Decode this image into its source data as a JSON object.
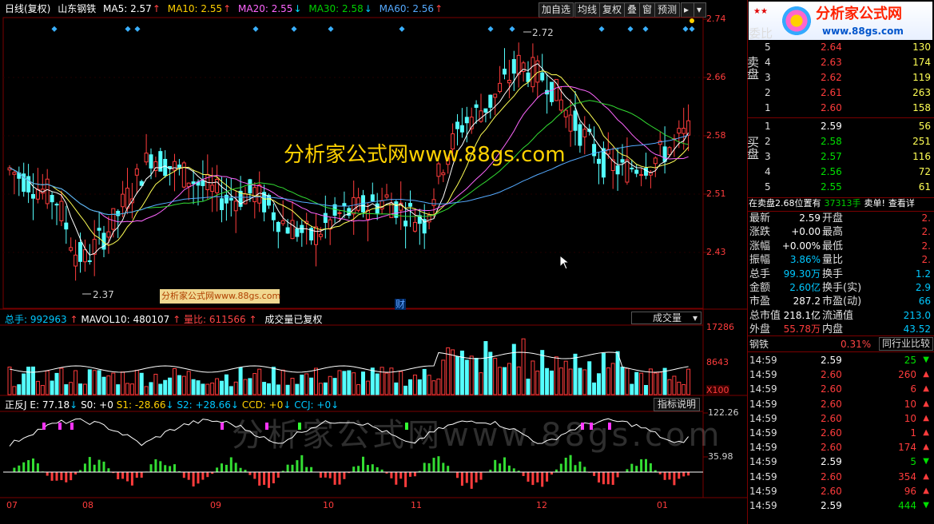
{
  "header": {
    "period": "日线(复权)",
    "stock_name": "山东钢铁",
    "ma5": "MA5: 2.57",
    "ma10": "MA10: 2.55",
    "ma20": "MA20: 2.55",
    "ma30": "MA30: 2.58",
    "ma60": "MA60: 2.56",
    "buttons": [
      "加自选",
      "均线",
      "复权",
      "叠",
      "窗",
      "预测"
    ]
  },
  "price_axis": [
    "2.74",
    "2.66",
    "2.58",
    "2.51",
    "2.43"
  ],
  "annotations": {
    "high": "2.72",
    "low": "2.37",
    "marker": "财",
    "watermark_main": "分析家公式网www.88gs.com",
    "watermark_small": "分析家公式网www.88gs.com",
    "watermark_indicator": "分析家公式网www.88gs.com"
  },
  "volume_panel": {
    "total": "总手: 992963",
    "mavol": "MAVOL10: 480107",
    "ratio": "量比: 611566",
    "note": "成交量已复权",
    "selector": "成交量",
    "axis": [
      "17286",
      "8643"
    ],
    "unit": "X100"
  },
  "indicator_panel": {
    "name": "正反J",
    "e": "E: 77.18",
    "s0": "S0: +0",
    "s1": "S1: -28.66",
    "s2": "S2: +28.66",
    "ccd": "CCD: +0",
    "ccj": "CCJ: +0",
    "help": "指标说明",
    "axis": [
      "122.26",
      "35.98"
    ]
  },
  "x_axis": [
    "07",
    "08",
    "09",
    "10",
    "11",
    "12",
    "01"
  ],
  "logo": {
    "title": "分析家公式网",
    "url": "www.88gs.com"
  },
  "orderbook": {
    "title": "委比",
    "sell_label": "卖盘",
    "buy_label": "买盘",
    "sell": [
      {
        "level": "5",
        "price": "2.64",
        "vol": "130"
      },
      {
        "level": "4",
        "price": "2.63",
        "vol": "174"
      },
      {
        "level": "3",
        "price": "2.62",
        "vol": "119"
      },
      {
        "level": "2",
        "price": "2.61",
        "vol": "263"
      },
      {
        "level": "1",
        "price": "2.60",
        "vol": "158"
      }
    ],
    "buy": [
      {
        "level": "1",
        "price": "2.59",
        "vol": "56"
      },
      {
        "level": "2",
        "price": "2.58",
        "vol": "251"
      },
      {
        "level": "3",
        "price": "2.57",
        "vol": "116"
      },
      {
        "level": "4",
        "price": "2.56",
        "vol": "72"
      },
      {
        "level": "5",
        "price": "2.55",
        "vol": "61"
      }
    ],
    "notice_a": "在卖盘2.68位置有",
    "notice_b": "37313手",
    "notice_c": "卖单!",
    "notice_d": "查看详"
  },
  "stats": [
    {
      "l1": "最新",
      "v1": "2.59",
      "l2": "开盘",
      "v2": "2."
    },
    {
      "l1": "涨跌",
      "v1": "+0.00",
      "l2": "最高",
      "v2": "2."
    },
    {
      "l1": "涨幅",
      "v1": "+0.00%",
      "l2": "最低",
      "v2": "2."
    },
    {
      "l1": "振幅",
      "v1": "3.86%",
      "l2": "量比",
      "v2": "2."
    },
    {
      "l1": "总手",
      "v1": "99.30万",
      "l2": "换手",
      "v2": "1.2"
    },
    {
      "l1": "金额",
      "v1": "2.60亿",
      "l2": "换手(实)",
      "v2": "2.9"
    },
    {
      "l1": "市盈",
      "v1": "287.2",
      "l2": "市盈(动)",
      "v2": "66"
    },
    {
      "l1": "总市值",
      "v1": "218.1亿",
      "l2": "流通值",
      "v2": "213.0"
    },
    {
      "l1": "外盘",
      "v1": "55.78万",
      "l2": "内盘",
      "v2": "43.52"
    }
  ],
  "sector": {
    "name": "钢铁",
    "change": "0.31%",
    "compare": "同行业比较"
  },
  "ticks": [
    {
      "time": "14:59",
      "price": "2.59",
      "vol": "25",
      "dir": "down"
    },
    {
      "time": "14:59",
      "price": "2.60",
      "vol": "260",
      "dir": "up"
    },
    {
      "time": "14:59",
      "price": "2.60",
      "vol": "6",
      "dir": "up"
    },
    {
      "time": "14:59",
      "price": "2.60",
      "vol": "10",
      "dir": "up"
    },
    {
      "time": "14:59",
      "price": "2.60",
      "vol": "10",
      "dir": "up"
    },
    {
      "time": "14:59",
      "price": "2.60",
      "vol": "1",
      "dir": "up"
    },
    {
      "time": "14:59",
      "price": "2.60",
      "vol": "174",
      "dir": "up"
    },
    {
      "time": "14:59",
      "price": "2.59",
      "vol": "5",
      "dir": "down"
    },
    {
      "time": "14:59",
      "price": "2.60",
      "vol": "354",
      "dir": "up"
    },
    {
      "time": "14:59",
      "price": "2.60",
      "vol": "96",
      "dir": "up"
    },
    {
      "time": "14:59",
      "price": "2.59",
      "vol": "444",
      "dir": "down"
    }
  ],
  "colors": {
    "up": "#ff3c3c",
    "down": "#54ffff",
    "ma5": "#ffffff",
    "ma10": "#ffff55",
    "ma20": "#ff66ff",
    "ma30": "#33dd33",
    "ma60": "#55aaff",
    "grid": "#7a0000"
  }
}
